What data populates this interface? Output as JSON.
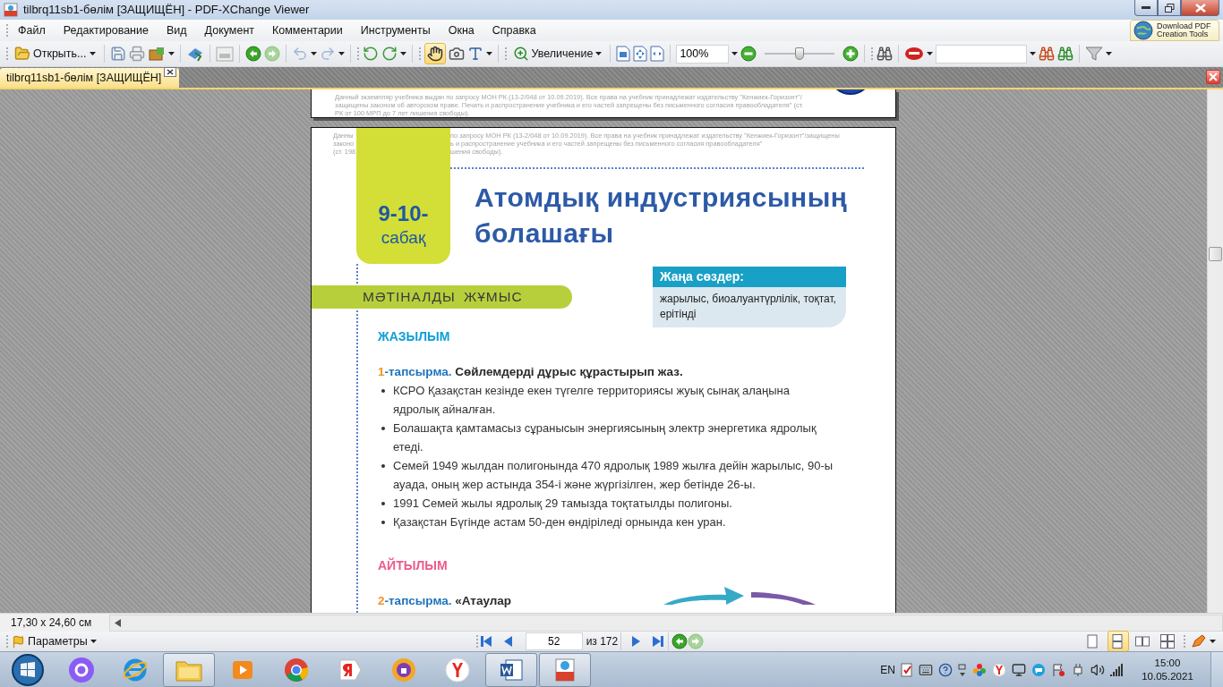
{
  "window": {
    "title": "tilbrq11sb1-бөлім [ЗАЩИЩЁН] - PDF-XChange Viewer"
  },
  "menu": [
    "Файл",
    "Редактирование",
    "Вид",
    "Документ",
    "Комментарии",
    "Инструменты",
    "Окна",
    "Справка"
  ],
  "promo_button": {
    "line_1": "Download PDF",
    "line_2": "Creation Tools"
  },
  "toolbar": {
    "open_label": "Открыть...",
    "zoom_label": "Увеличение",
    "zoom_value": "100%",
    "zoom_slider": {
      "level": 0.5
    },
    "hand_tool": {
      "selected": true
    }
  },
  "tabs": [
    {
      "label": "tilbrq11sb1-бөлім [ЗАЩИЩЁН]",
      "selected": true
    }
  ],
  "document": {
    "previous_page_notice": [
      "Данный экземпляр учебника выдан по запросу МОН РК (13-2/048 от 10.09.2019). Все права на учебник принадлежат издательству \"Кенжиек-Горизонт\"/",
      "защищены законом об авторском праве. Печать и распространение учебника и его частей запрещены без письменного согласия правообладателя\" (ст.",
      "РК от 100 МРП до 7 лет лишения свободы)."
    ],
    "page": {
      "notice_lines": [
        [
          "Данны",
          "по запросу МОН РК (13-2/048 от 10.09.2019). Все права на учебник принадлежат издательству \"Кенжиек-Горизонт\"/защищены"
        ],
        [
          "законо",
          "ь и распространение учебника и его частей запрещены без письменного согласия правообладателя\""
        ],
        [
          "(ст. 198",
          "шения свободы)."
        ]
      ],
      "lesson_badge": {
        "number": "9-10-",
        "word": "сабақ"
      },
      "title": "Атомдық индустриясының болашағы",
      "new_words": {
        "heading": "Жаңа сөздер:",
        "text": "жарылыс, биоалуантүрлілік, тоқтат, ерітінді"
      },
      "section_banner": "МӘТІНАЛДЫ ЖҰМЫС",
      "sections": [
        {
          "heading": "ЖАЗЫЛЫМ",
          "color": "#0f9fd6",
          "task": {
            "number": "1",
            "label": "-тапсырма.",
            "text": "Сөйлемдерді дұрыс құрастырып жаз."
          },
          "bullets": [
            "КСРО Қазақстан кезінде екен түгелге территориясы жуық сынақ алаңына ядролық айналған.",
            "Болашақта қамтамасыз сұранысын энергиясының электр энергетика ядролық етеді.",
            "Семей 1949 жылдан полигонында 470 ядролық 1989 жылға дейін жарылыс, 90-ы ауада, оның жер астында 354-і және жүргізілген, жер бетінде 26-ы.",
            "1991 Семей жылы ядролық 29 тамызда тоқтатылды полигоны.",
            "Қазақстан Бүгінде астам 50-ден өндіріледі орнында кен уран."
          ]
        },
        {
          "heading": "АЙТЫЛЫМ",
          "color": "#ec5a8c",
          "task": {
            "number": "2",
            "label": "-тапсырма.",
            "text": "«Атаулар"
          }
        }
      ]
    }
  },
  "status": {
    "page_size": "17,30 x 24,60 см"
  },
  "bottom_bar": {
    "options_label": "Параметры",
    "page_number": "52",
    "page_total": "из 172",
    "views": [
      {
        "selected": false
      },
      {
        "selected": true
      },
      {
        "selected": false
      },
      {
        "selected": false
      }
    ]
  },
  "taskbar": {
    "apps": [
      {
        "kind": "assistant",
        "running": false
      },
      {
        "kind": "ie",
        "running": false
      },
      {
        "kind": "explorer",
        "running": true
      },
      {
        "kind": "media",
        "running": false
      },
      {
        "kind": "chrome",
        "running": false
      },
      {
        "kind": "yandex-browser",
        "running": false
      },
      {
        "kind": "shield-browser",
        "running": false
      },
      {
        "kind": "yandex",
        "running": false
      },
      {
        "kind": "word",
        "running": true
      },
      {
        "kind": "pdf-viewer",
        "running": true
      }
    ],
    "language": "EN",
    "time": "15:00",
    "date": "10.05.2021"
  }
}
